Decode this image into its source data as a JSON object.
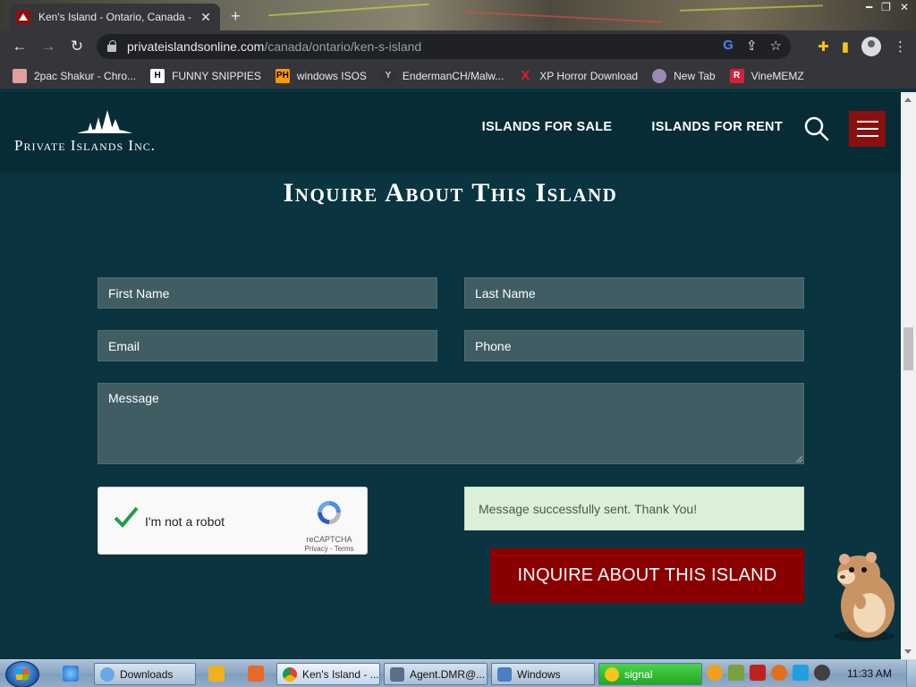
{
  "browser": {
    "tab_title": "Ken's Island - Ontario, Canada - ",
    "url_host": "privateislandsonline.com",
    "url_path": "/canada/ontario/ken-s-island",
    "bookmarks": [
      {
        "label": "2pac Shakur - Chro...",
        "icon": "bookmark-2pac-icon",
        "color": "#e0a0a0"
      },
      {
        "label": "FUNNY SNIPPIES",
        "icon": "bookmark-h-icon",
        "color": "#ffffff"
      },
      {
        "label": "windows ISOS",
        "icon": "bookmark-ph-icon",
        "color": "#ff9900"
      },
      {
        "label": "EndermanCH/Malw...",
        "icon": "bookmark-yp-icon",
        "color": "#333333"
      },
      {
        "label": "XP Horror Download",
        "icon": "bookmark-x-icon",
        "color": "#e02020"
      },
      {
        "label": "New Tab",
        "icon": "bookmark-newtab-icon",
        "color": "#9a8ab0"
      },
      {
        "label": "VineMEMZ",
        "icon": "bookmark-r-icon",
        "color": "#d4213d"
      }
    ]
  },
  "site": {
    "logo_text": "Private Islands Inc.",
    "nav": {
      "sale": "ISLANDS FOR SALE",
      "rent": "ISLANDS FOR RENT"
    }
  },
  "form": {
    "heading": "Inquire About This Island",
    "first_name_placeholder": "First Name",
    "last_name_placeholder": "Last Name",
    "email_placeholder": "Email",
    "phone_placeholder": "Phone",
    "message_placeholder": "Message",
    "captcha_label": "I'm not a robot",
    "captcha_brand": "reCAPTCHA",
    "captcha_links": "Privacy - Terms",
    "success_message": "Message successfully sent. Thank You!",
    "submit_label": "INQUIRE ABOUT THIS ISLAND"
  },
  "taskbar": {
    "items": [
      {
        "label": "Downloads"
      },
      {
        "label": "Ken's Island - ..."
      },
      {
        "label": "Agent.DMR@..."
      },
      {
        "label": "Windows"
      },
      {
        "label": "signal"
      }
    ],
    "clock": "11:33 AM"
  },
  "colors": {
    "page_bg": "#093440",
    "accent_red": "#8a0000",
    "success_bg": "#dcefd8"
  }
}
